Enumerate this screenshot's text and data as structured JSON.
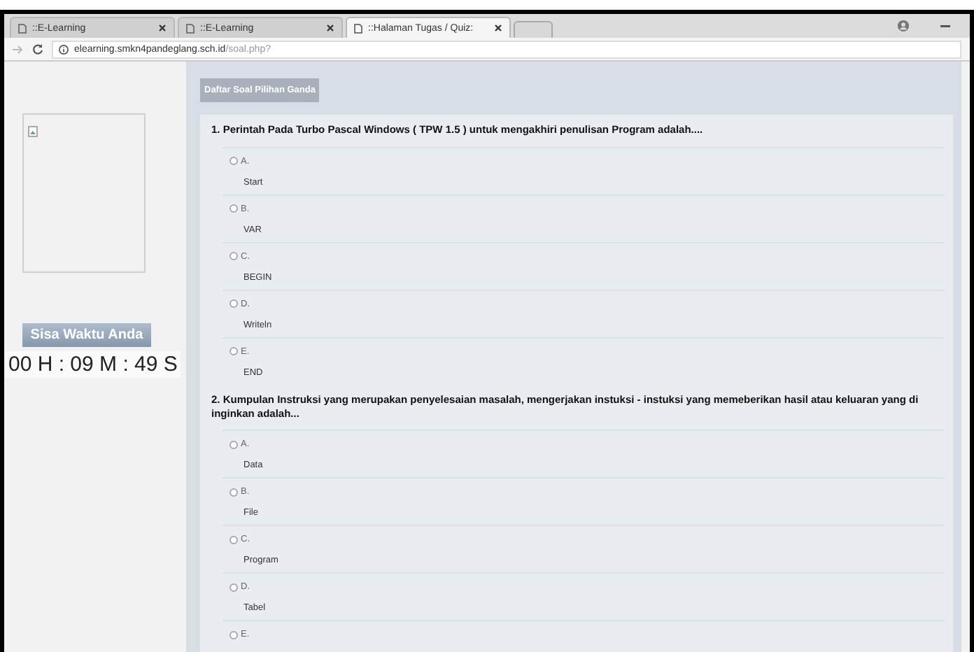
{
  "browser": {
    "tabs": [
      {
        "title": "::E-Learning",
        "selected": false
      },
      {
        "title": "::E-Learning",
        "selected": false
      },
      {
        "title": "::Halaman Tugas / Quiz:",
        "selected": true
      }
    ],
    "address": {
      "host": "elearning.smkn4pandeglang.sch.id",
      "path": "/soal.php?"
    }
  },
  "sidebar": {
    "timer_label": "Sisa Waktu Anda",
    "timer": "00 H : 09 M : 49 S"
  },
  "panel": {
    "heading": "Daftar Soal Pilihan Ganda",
    "questions": [
      {
        "text": "1.  Perintah Pada Turbo Pascal Windows ( TPW 1.5 ) untuk mengakhiri penulisan Program adalah....",
        "options": [
          {
            "letter": "A.",
            "text": "Start",
            "selected": false
          },
          {
            "letter": "B.",
            "text": "VAR",
            "selected": false
          },
          {
            "letter": "C.",
            "text": "BEGIN",
            "selected": false
          },
          {
            "letter": "D.",
            "text": "Writeln",
            "selected": false
          },
          {
            "letter": "E.",
            "text": "END",
            "selected": false
          }
        ]
      },
      {
        "text": "2.  Kumpulan Instruksi yang merupakan penyelesaian masalah, mengerjakan instuksi  - instuksi yang memeberikan hasil atau keluaran yang di inginkan adalah...",
        "options": [
          {
            "letter": "A.",
            "text": "Data",
            "selected": false
          },
          {
            "letter": "B.",
            "text": "File",
            "selected": false
          },
          {
            "letter": "C.",
            "text": "Program",
            "selected": false
          },
          {
            "letter": "D.",
            "text": "Tabel",
            "selected": false
          },
          {
            "letter": "E.",
            "selected": false
          }
        ]
      }
    ]
  }
}
